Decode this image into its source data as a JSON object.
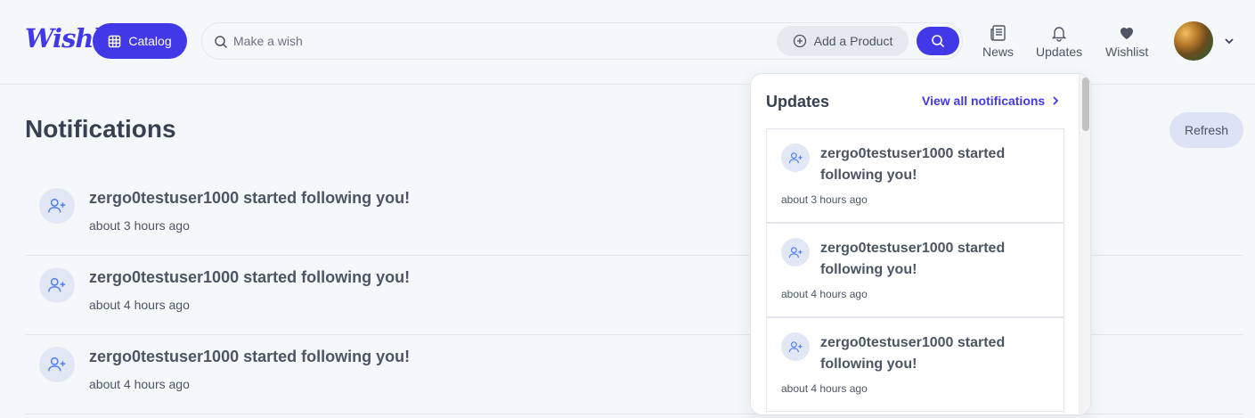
{
  "header": {
    "logo": "Wishly",
    "catalog_label": "Catalog",
    "search_placeholder": "Make a wish",
    "add_product_label": "Add a Product",
    "nav": [
      {
        "label": "News",
        "icon": "newspaper-icon"
      },
      {
        "label": "Updates",
        "icon": "bell-icon"
      },
      {
        "label": "Wishlist",
        "icon": "heart-icon"
      }
    ]
  },
  "main": {
    "title": "Notifications",
    "refresh_label": "Refresh",
    "notifications": [
      {
        "text": "zergo0testuser1000 started following you!",
        "time": "about 3 hours ago"
      },
      {
        "text": "zergo0testuser1000 started following you!",
        "time": "about 4 hours ago"
      },
      {
        "text": "zergo0testuser1000 started following you!",
        "time": "about 4 hours ago"
      }
    ]
  },
  "dropdown": {
    "title": "Updates",
    "view_all_label": "View all notifications",
    "items": [
      {
        "text": "zergo0testuser1000 started following you!",
        "time": "about 3 hours ago"
      },
      {
        "text": "zergo0testuser1000 started following you!",
        "time": "about 4 hours ago"
      },
      {
        "text": "zergo0testuser1000 started following you!",
        "time": "about 4 hours ago"
      }
    ]
  },
  "colors": {
    "accent": "#4338e8",
    "background": "#f5f8fb"
  }
}
